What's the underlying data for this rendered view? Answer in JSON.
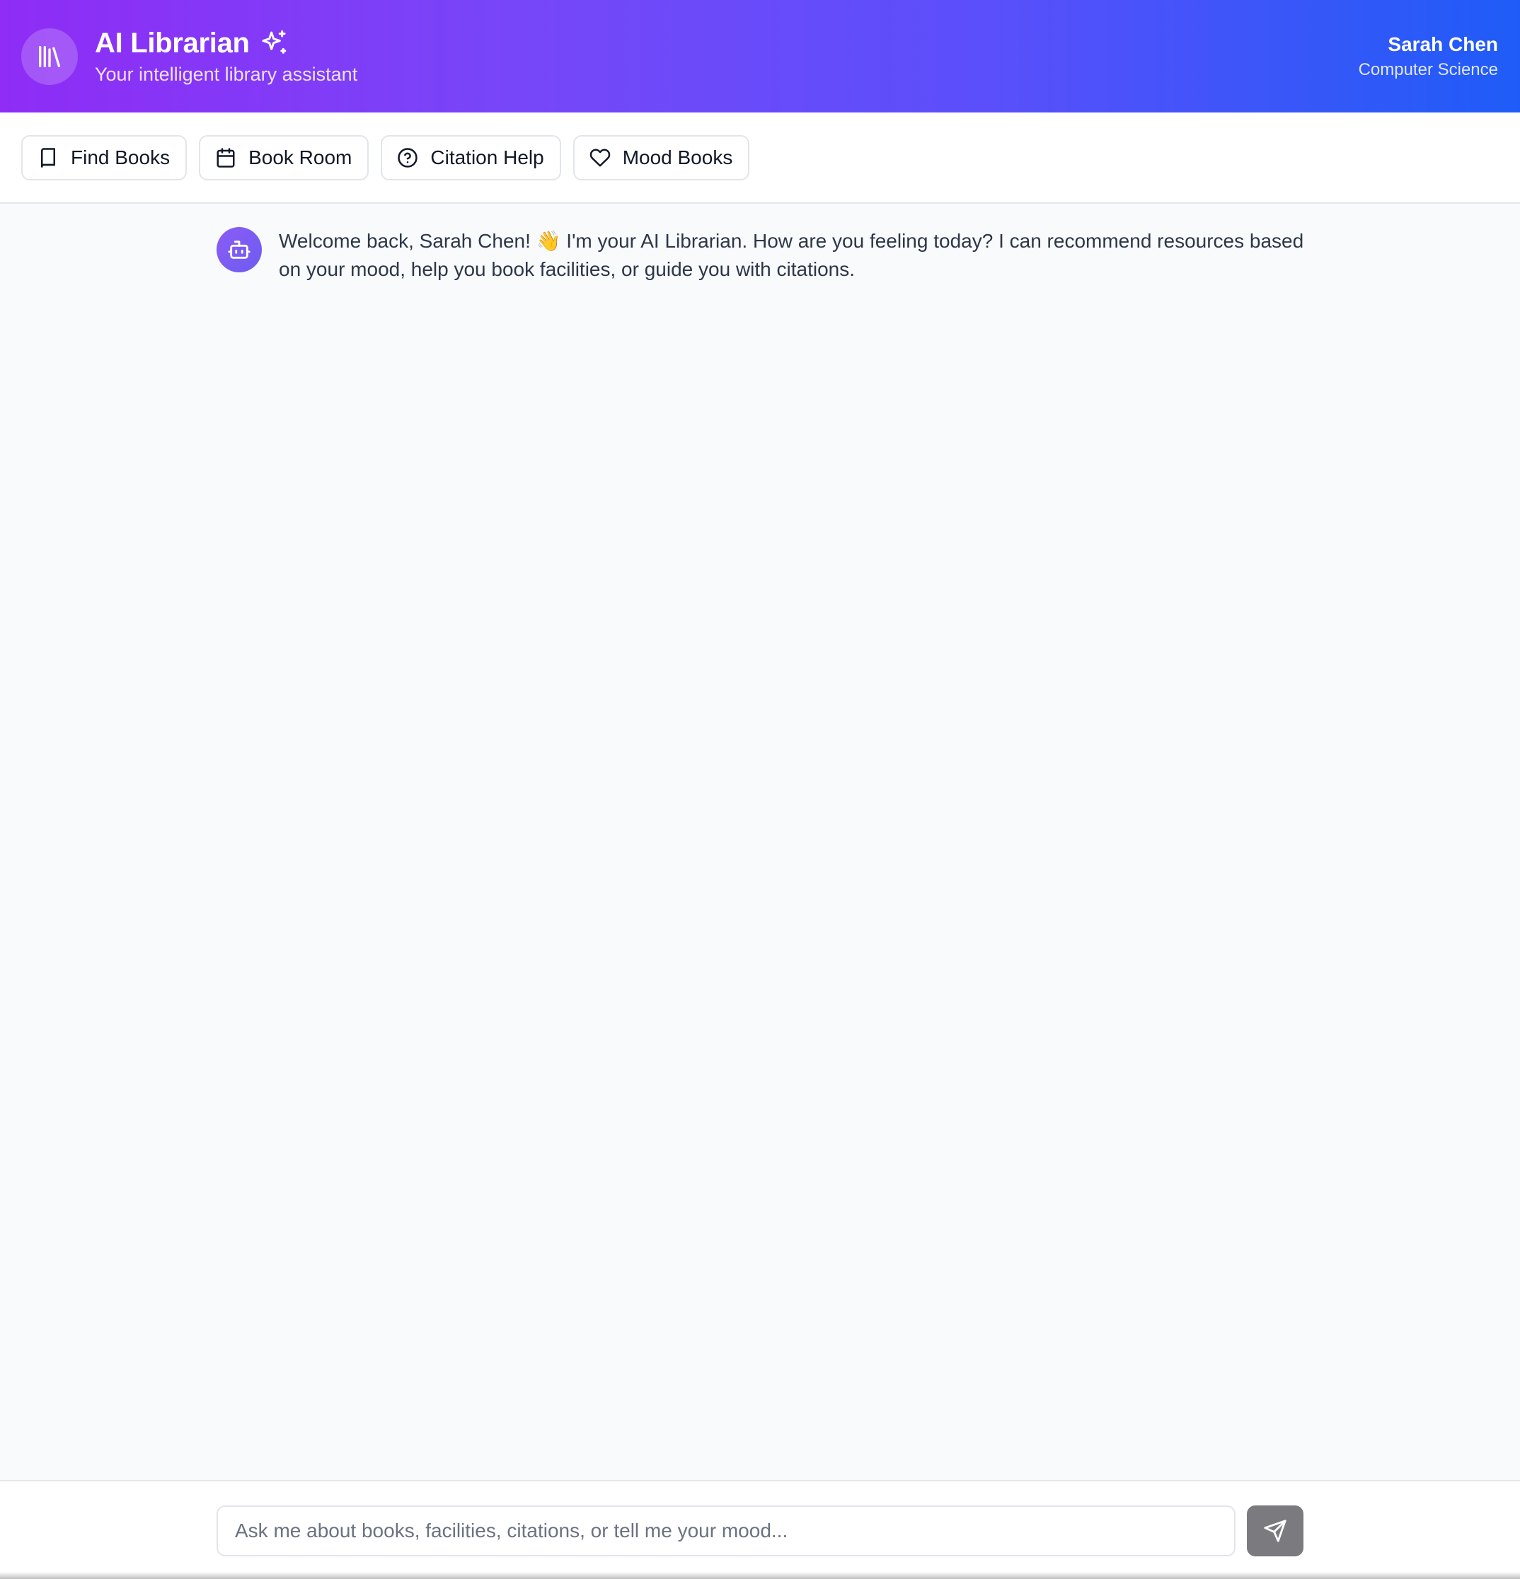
{
  "header": {
    "title": "AI Librarian",
    "subtitle": "Your intelligent library assistant",
    "logo_icon": "library-icon",
    "title_icon": "sparkles-icon",
    "gradient_start": "#8f2cf6",
    "gradient_end": "#1f5cf7"
  },
  "user": {
    "name": "Sarah Chen",
    "department": "Computer Science"
  },
  "quick_actions": [
    {
      "label": "Find Books",
      "icon": "book-icon"
    },
    {
      "label": "Book Room",
      "icon": "calendar-icon"
    },
    {
      "label": "Citation Help",
      "icon": "help-circle-icon"
    },
    {
      "label": "Mood Books",
      "icon": "heart-icon"
    }
  ],
  "chat": {
    "messages": [
      {
        "sender": "bot",
        "avatar_icon": "bot-icon",
        "text": "Welcome back, Sarah Chen! 👋 I'm your AI Librarian. How are you feeling today? I can recommend resources based on your mood, help you book facilities, or guide you with citations."
      }
    ]
  },
  "composer": {
    "value": "",
    "placeholder": "Ask me about books, facilities, citations, or tell me your mood...",
    "send_icon": "send-icon",
    "send_button_color": "#7b7b7f"
  }
}
